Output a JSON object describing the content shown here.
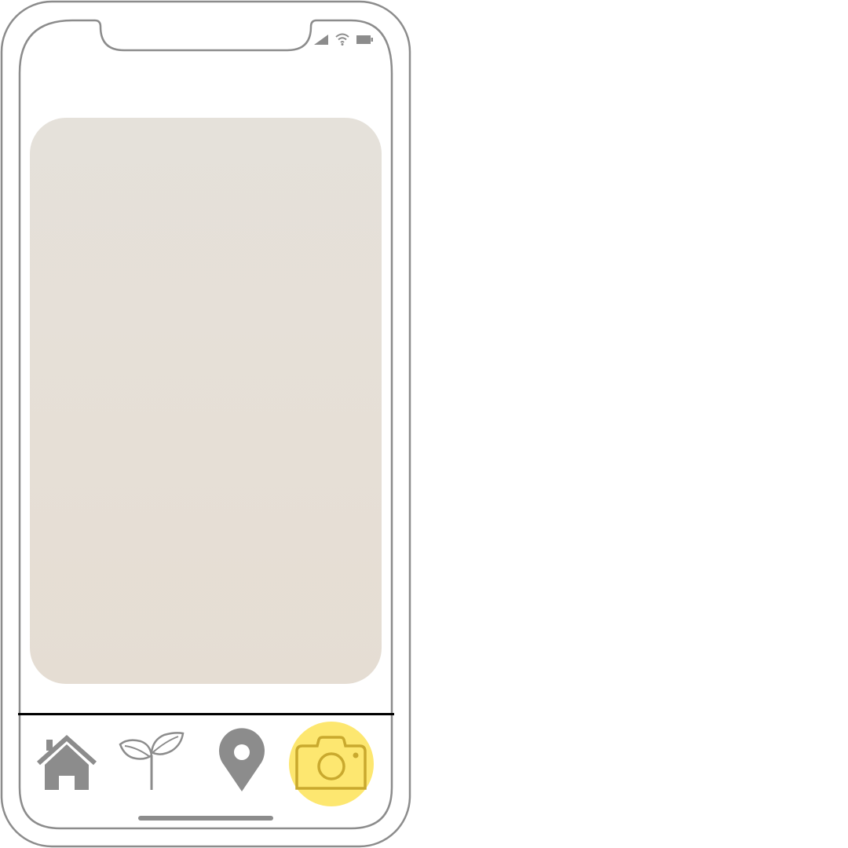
{
  "colors": {
    "frame_stroke": "#8c8c8c",
    "icon_gray": "#8c8c8c",
    "preview_bg": "#e5dfd6",
    "active_highlight": "#fde770",
    "active_icon": "#c9a92e",
    "divider": "#000000"
  },
  "status_bar": {
    "icons": [
      "cellular-signal-icon",
      "wifi-icon",
      "battery-icon"
    ]
  },
  "tab_bar": {
    "active_tab": "camera",
    "tabs": [
      {
        "id": "home",
        "icon": "house-icon"
      },
      {
        "id": "plant",
        "icon": "sprout-icon"
      },
      {
        "id": "map",
        "icon": "location-pin-icon"
      },
      {
        "id": "camera",
        "icon": "camera-icon"
      }
    ]
  }
}
